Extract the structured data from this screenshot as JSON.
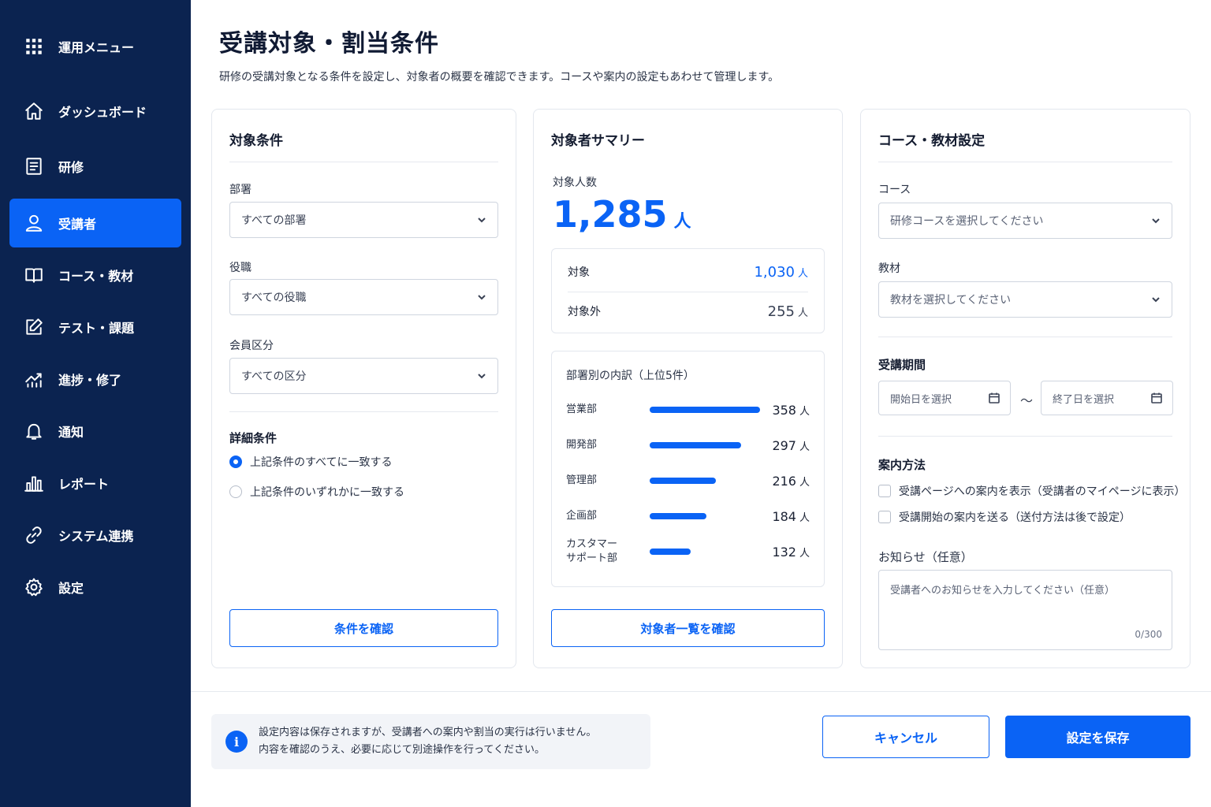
{
  "sidebar": {
    "menu_title": "運用メニュー",
    "items": [
      {
        "label": "ダッシュボード",
        "icon": "home-icon"
      },
      {
        "label": "研修",
        "icon": "document-icon"
      },
      {
        "label": "受講者",
        "icon": "user-icon",
        "active": true
      },
      {
        "label": "コース・教材",
        "icon": "book-icon"
      },
      {
        "label": "テスト・課題",
        "icon": "edit-icon"
      },
      {
        "label": "進捗・修了",
        "icon": "trend-icon"
      },
      {
        "label": "通知",
        "icon": "bell-icon"
      },
      {
        "label": "レポート",
        "icon": "bar-chart-icon"
      },
      {
        "label": "システム連携",
        "icon": "link-icon"
      },
      {
        "label": "設定",
        "icon": "gear-icon"
      }
    ]
  },
  "page": {
    "title": "受講対象・割当条件",
    "description": "研修の受講対象となる条件を設定し、対象者の概要を確認できます。コースや案内の設定もあわせて管理します。"
  },
  "conditions": {
    "title": "対象条件",
    "department_label": "部署",
    "department_value": "すべての部署",
    "position_label": "役職",
    "position_value": "すべての役職",
    "member_label": "会員区分",
    "member_value": "すべての区分",
    "detail_label": "詳細条件",
    "radio_all": "上記条件のすべてに一致する",
    "radio_any": "上記条件のいずれかに一致する",
    "confirm_button": "条件を確認"
  },
  "summary": {
    "title": "対象者サマリー",
    "count_label": "対象人数",
    "count_value": "1,285",
    "unit": "人",
    "target_label": "対象",
    "target_value": "1,030",
    "excluded_label": "対象外",
    "excluded_value": "255",
    "breakdown_title": "部署別の内訳（上位5件）",
    "list_button": "対象者一覧を確認",
    "color_accent": "#0a63f5"
  },
  "chart_data": {
    "type": "bar",
    "categories": [
      "営業部",
      "開発部",
      "管理部",
      "企画部",
      "カスタマーサポート部"
    ],
    "values": [
      358,
      297,
      216,
      184,
      132
    ]
  },
  "course": {
    "title": "コース・教材設定",
    "course_label": "コース",
    "course_placeholder": "研修コースを選択してください",
    "material_label": "教材",
    "material_placeholder": "教材を選択してください",
    "period_label": "受講期間",
    "start_placeholder": "開始日を選択",
    "tilde": "〜",
    "end_placeholder": "終了日を選択",
    "guide_label": "案内方法",
    "guide_page": "受講ページへの案内を表示（受講者のマイページに表示）",
    "guide_send": "受講開始の案内を送る（送付方法は後で設定）",
    "notice_label": "お知らせ（任意）",
    "notice_placeholder": "受講者へのお知らせを入力してください（任意）",
    "notice_counter": "0/300"
  },
  "footer": {
    "notice_line1": "設定内容は保存されますが、受講者への案内や割当の実行は行いません。",
    "notice_line2": "内容を確認のうえ、必要に応じて別途操作を行ってください。",
    "info_glyph": "i",
    "cancel": "キャンセル",
    "save": "設定を保存"
  }
}
